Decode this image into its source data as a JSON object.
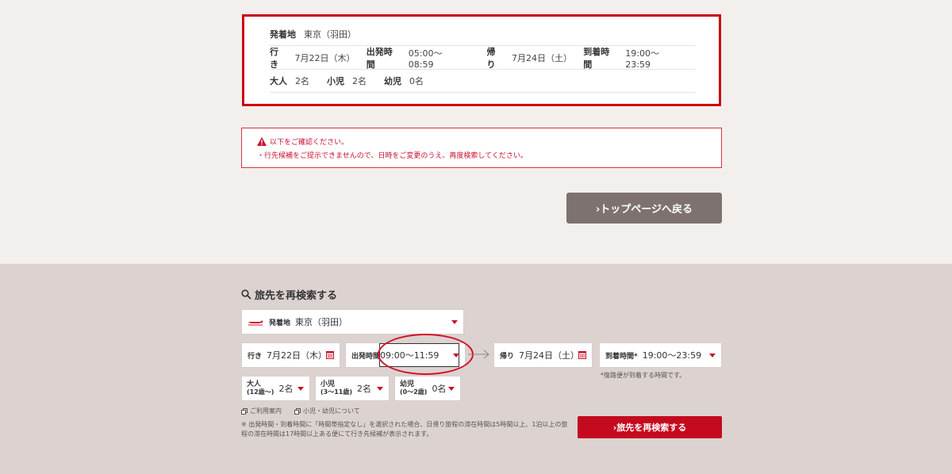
{
  "summary": {
    "origin_label": "発着地",
    "origin_value": "東京（羽田）",
    "outbound_label": "行き",
    "outbound_value": "7月22日（木）",
    "depart_time_label": "出発時間",
    "depart_time_value": "05:00～08:59",
    "return_label": "帰り",
    "return_value": "7月24日（土）",
    "arrive_time_label": "到着時間",
    "arrive_time_value": "19:00～23:59",
    "adult_label": "大人",
    "adult_value": "2名",
    "child_label": "小児",
    "child_value": "2名",
    "infant_label": "幼児",
    "infant_value": "0名"
  },
  "alert": {
    "line1": "以下をご確認ください。",
    "line2": "・行先候補をご提示できませんので、日時をご変更のうえ、再度検索してください。"
  },
  "back_button": "›トップページへ戻る",
  "research": {
    "title": "旅先を再検索する",
    "origin_label": "発着地",
    "origin_value": "東京（羽田）",
    "outbound_label": "行き",
    "outbound_value": "7月22日（木）",
    "depart_time_label": "出発時間",
    "depart_time_value": "09:00～11:59",
    "return_label": "帰り",
    "return_value": "7月24日（土）",
    "arrive_time_label": "到着時間*",
    "arrive_time_value": "19:00～23:59",
    "arrive_note": "*復路便が到着する時間です。",
    "adult_label": "大人",
    "adult_sub": "(12歳～)",
    "adult_value": "2名",
    "child_label": "小児",
    "child_sub": "(3～11歳)",
    "child_value": "2名",
    "infant_label": "幼児",
    "infant_sub": "(0～2歳)",
    "infant_value": "0名",
    "link_guide": "ご利用案内",
    "link_child": "小児・幼児について",
    "footnote": "※ 出発時間・到着時間に「時間帯指定なし」を選択された場合、日帰り旅程の滞在時間は5時間以上、1泊以上の旅程の滞在時間は17時間以上ある便にて行き先候補が表示されます。",
    "submit_button": "›旅先を再検索する"
  },
  "colors": {
    "accent_red": "#c8102e",
    "back_button_bg": "#7d7270",
    "lower_panel_bg": "#dcd3d0"
  }
}
